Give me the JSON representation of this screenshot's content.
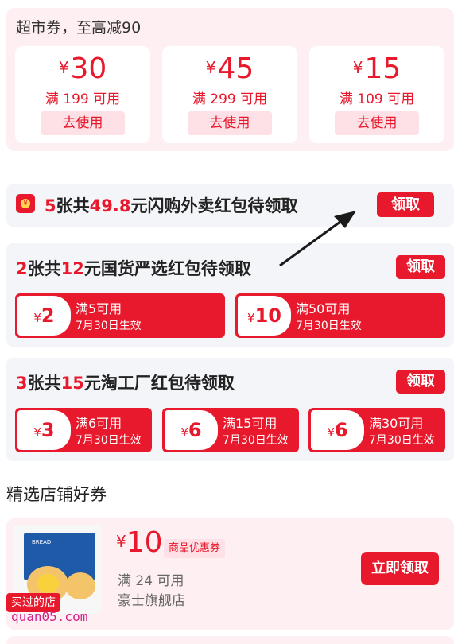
{
  "supermarket": {
    "title": "超市券，至高减90",
    "coupons": [
      {
        "currency": "¥",
        "amount": "30",
        "condition": "满 199 可用",
        "button": "去使用"
      },
      {
        "currency": "¥",
        "amount": "45",
        "condition": "满 299 可用",
        "button": "去使用"
      },
      {
        "currency": "¥",
        "amount": "15",
        "condition": "满 109 可用",
        "button": "去使用"
      }
    ]
  },
  "banner": {
    "count": "5",
    "count_unit": "张共",
    "total": "49.8",
    "suffix": "元闪购外卖红包待领取",
    "button": "领取"
  },
  "packets": [
    {
      "count": "2",
      "count_unit": "张共",
      "total": "12",
      "suffix": "元国货严选红包待领取",
      "button": "领取",
      "items": [
        {
          "currency": "¥",
          "amount": "2",
          "condition": "满5可用",
          "validity": "7月30日生效"
        },
        {
          "currency": "¥",
          "amount": "10",
          "condition": "满50可用",
          "validity": "7月30日生效"
        }
      ]
    },
    {
      "count": "3",
      "count_unit": "张共",
      "total": "15",
      "suffix": "元淘工厂红包待领取",
      "button": "领取",
      "items": [
        {
          "currency": "¥",
          "amount": "3",
          "condition": "满6可用",
          "validity": "7月30日生效"
        },
        {
          "currency": "¥",
          "amount": "6",
          "condition": "满15可用",
          "validity": "7月30日生效"
        },
        {
          "currency": "¥",
          "amount": "6",
          "condition": "满30可用",
          "validity": "7月30日生效"
        }
      ]
    }
  ],
  "shop_section": {
    "title": "精选店铺好券",
    "coupon": {
      "currency": "¥",
      "amount": "10",
      "type": "商品优惠券",
      "condition": "满 24 可用",
      "shop": "豪士旗舰店",
      "button": "立即领取",
      "badge": "买过的店",
      "product_label": "BREAD"
    }
  },
  "watermark": "quan05.com",
  "colors": {
    "accent": "#e8192c",
    "soft_pink": "#fdeff2",
    "panel_gray": "#f4f5f9"
  },
  "icons": {
    "banner_icon": "red-packet-icon",
    "annotation": "arrow-annotation"
  }
}
